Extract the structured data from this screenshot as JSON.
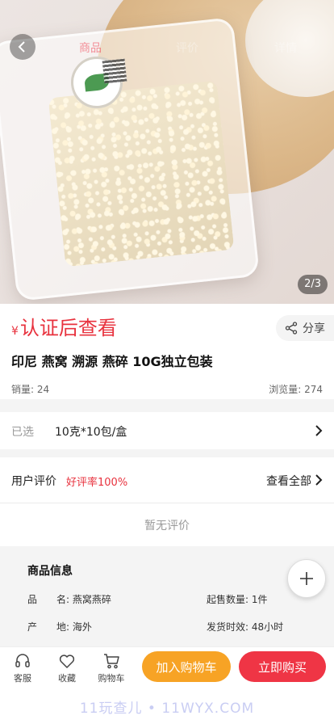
{
  "top_tabs": [
    "商品",
    "评价",
    "详情"
  ],
  "image_counter": "2/3",
  "price": {
    "currency": "¥",
    "text": "认证后查看"
  },
  "share_label": "分享",
  "product_title": "印尼 燕窝 溯源 燕碎 10G独立包装",
  "sales": "销量: 24",
  "views": "浏览量: 274",
  "spec": {
    "label": "已选",
    "value": "10克*10包/盒"
  },
  "reviews": {
    "label": "用户评价",
    "rate": "好评率100%",
    "view_all": "查看全部",
    "empty": "暂无评价"
  },
  "details": {
    "heading": "商品信息",
    "rows": [
      {
        "left": "品　　名: 燕窝燕碎",
        "right": "起售数量: 1件"
      },
      {
        "left": "产　　地: 海外",
        "right": "发货时效: 48小时"
      }
    ]
  },
  "bottom_bar": {
    "service": "客服",
    "favorite": "收藏",
    "cart": "购物车",
    "add_to_cart": "加入购物车",
    "buy_now": "立即购买"
  },
  "watermark": "11玩查儿 • 11WYX.COM",
  "colors": {
    "accent_red": "#ef3545",
    "accent_orange": "#f7a325",
    "price_red": "#e8323e"
  }
}
